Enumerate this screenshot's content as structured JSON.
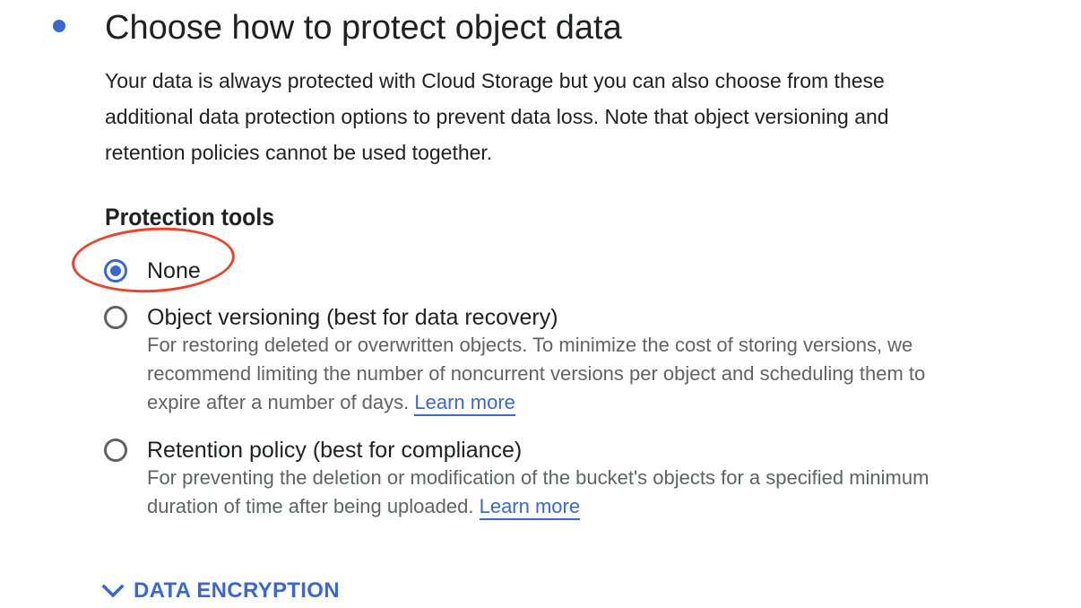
{
  "step": {
    "title": "Choose how to protect object data",
    "description": "Your data is always protected with Cloud Storage but you can also choose from these additional data protection options to prevent data loss. Note that object versioning and retention policies cannot be used together."
  },
  "protection_tools": {
    "heading": "Protection tools",
    "selected": "None",
    "options": [
      {
        "label": "None",
        "checked": true
      },
      {
        "label": "Object versioning (best for data recovery)",
        "description": "For restoring deleted or overwritten objects. To minimize the cost of storing versions, we recommend limiting the number of noncurrent versions per object and scheduling them to expire after a number of days.",
        "link_text": "Learn more",
        "checked": false
      },
      {
        "label": "Retention policy (best for compliance)",
        "description": "For preventing the deletion or modification of the bucket's objects for a specified minimum duration of time after being uploaded.",
        "link_text": "Learn more",
        "checked": false
      }
    ]
  },
  "data_encryption": {
    "label": "DATA ENCRYPTION",
    "icon": "chevron-down-icon"
  },
  "colors": {
    "accent": "#3b67d1",
    "annotation": "#e8452c",
    "text": "#202124",
    "secondary_text": "#5f6368"
  }
}
